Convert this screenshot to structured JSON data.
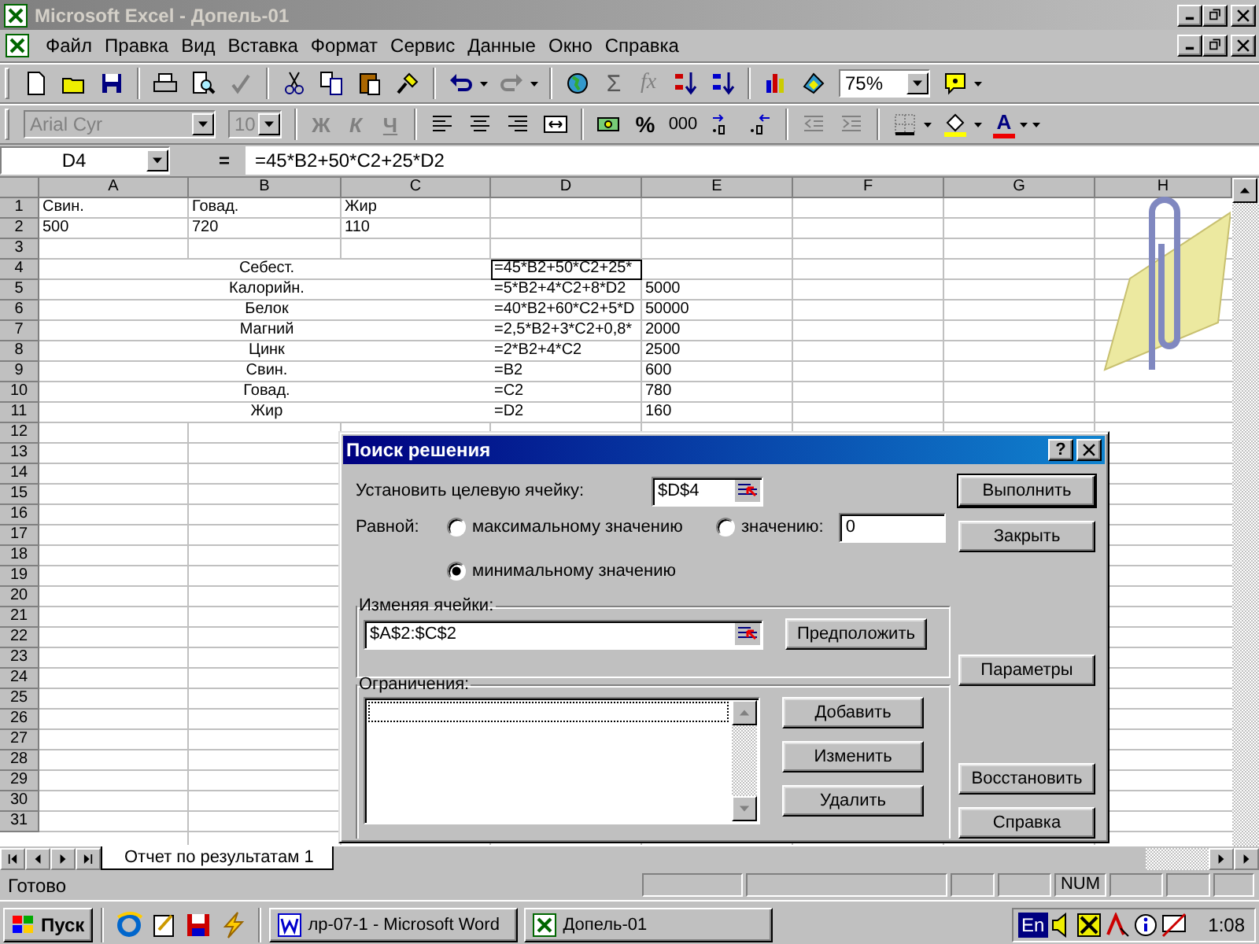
{
  "window": {
    "title": "Microsoft Excel - Допель-01",
    "active": false
  },
  "menu": [
    "Файл",
    "Правка",
    "Вид",
    "Вставка",
    "Формат",
    "Сервис",
    "Данные",
    "Окно",
    "Справка"
  ],
  "standard_toolbar": {
    "sum": "Σ",
    "function": "fx",
    "zoom": "75%"
  },
  "formatting_toolbar": {
    "font": "Arial Cyr",
    "size": "10",
    "disabled": true,
    "bold": "Ж",
    "italic": "К",
    "underline": "Ч",
    "percent": "%",
    "thousands": "000",
    "font_color": "A"
  },
  "formula_bar": {
    "name_box": "D4",
    "equals": "=",
    "formula": "=45*B2+50*C2+25*D2"
  },
  "sheet": {
    "columns": [
      "A",
      "B",
      "C",
      "D",
      "E",
      "F",
      "G",
      "H"
    ],
    "rows": [
      {
        "number": "1",
        "cells": {
          "A": "Свин.",
          "B": "Говад.",
          "C": "Жир"
        }
      },
      {
        "number": "2",
        "cells": {
          "A": "500",
          "B": "720",
          "C": "110"
        }
      },
      {
        "number": "3"
      },
      {
        "number": "4",
        "label": "Себест.",
        "cells": {
          "D": "=45*B2+50*C2+25*"
        },
        "d_selected": true
      },
      {
        "number": "5",
        "label": "Калорийн.",
        "cells": {
          "D": "=5*B2+4*C2+8*D2",
          "E": "5000"
        },
        "d_selected": false
      },
      {
        "number": "6",
        "label": "Белок",
        "cells": {
          "D": "=40*B2+60*C2+5*D",
          "E": "50000"
        },
        "d_selected": false
      },
      {
        "number": "7",
        "label": "Магний",
        "cells": {
          "D": "=2,5*B2+3*C2+0,8*",
          "E": "2000"
        },
        "d_selected": false
      },
      {
        "number": "8",
        "label": "Цинк",
        "cells": {
          "D": "=2*B2+4*C2",
          "E": "2500"
        },
        "d_selected": false
      },
      {
        "number": "9",
        "label": "Свин.",
        "cells": {
          "D": "=B2",
          "E": "600"
        },
        "d_selected": false
      },
      {
        "number": "10",
        "label": "Говад.",
        "cells": {
          "D": "=C2",
          "E": "780"
        },
        "d_selected": false
      },
      {
        "number": "11",
        "label": "Жир",
        "cells": {
          "D": "=D2",
          "E": "160"
        },
        "d_selected": false
      },
      {
        "number": "12"
      },
      {
        "number": "13"
      },
      {
        "number": "14"
      },
      {
        "number": "15"
      },
      {
        "number": "16"
      },
      {
        "number": "17"
      },
      {
        "number": "18"
      },
      {
        "number": "19"
      },
      {
        "number": "20"
      },
      {
        "number": "21"
      },
      {
        "number": "22"
      },
      {
        "number": "23"
      },
      {
        "number": "24"
      },
      {
        "number": "25"
      },
      {
        "number": "26"
      },
      {
        "number": "27"
      },
      {
        "number": "28"
      },
      {
        "number": "29"
      },
      {
        "number": "30"
      },
      {
        "number": "31"
      }
    ]
  },
  "sheet_tabs": [
    {
      "label": "Отчет по результатам 1",
      "selected": true
    }
  ],
  "status_bar": {
    "text": "Готово",
    "indicator": "NUM"
  },
  "dialog": {
    "title": "Поиск решения",
    "help": "?",
    "target_label": "Установить целевую ячейку:",
    "target": "$D$4",
    "equal_label": "Равной:",
    "options": [
      {
        "label": "максимальному значению",
        "selected": false
      },
      {
        "label": "значению:",
        "selected": false,
        "value": "0"
      },
      {
        "label": "минимальному значению",
        "selected": true
      }
    ],
    "changing_label": "Изменяя ячейки:",
    "changing": "$A$2:$C$2",
    "guess_button": "Предположить",
    "constraints_label": "Ограничения:",
    "constraint_buttons": [
      "Добавить",
      "Изменить",
      "Удалить"
    ],
    "side_buttons": [
      {
        "label": "Выполнить",
        "default": true
      },
      {
        "label": "Закрыть",
        "default": false
      },
      {
        "label": "Параметры",
        "default": false
      },
      {
        "label": "Восстановить",
        "default": false
      },
      {
        "label": "Справка",
        "default": false
      }
    ]
  },
  "taskbar": {
    "start": "Пуск",
    "tasks": [
      {
        "label": "лр-07-1 - Microsoft Word",
        "selected": false,
        "kind": "word"
      },
      {
        "label": "Допель-01",
        "selected": false,
        "kind": "excel"
      }
    ],
    "language": "En",
    "clock": "1:08"
  }
}
